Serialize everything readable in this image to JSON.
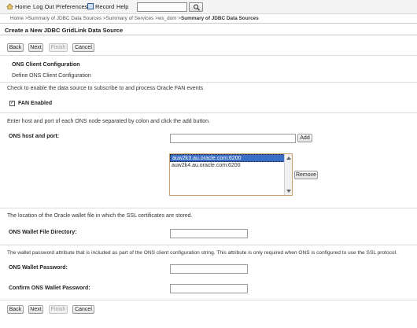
{
  "topnav": {
    "home": "Home",
    "logout": "Log Out",
    "preferences": "Preferences",
    "record": "Record",
    "help": "Help"
  },
  "breadcrumb": {
    "prefix": "Home >Summary of JDBC Data Sources >Summary of Services >ws_dom >",
    "current": "Summary of JDBC Data Sources"
  },
  "page_title": "Create a New JDBC GridLink Data Source",
  "buttons": {
    "back": "Back",
    "next": "Next",
    "finish": "Finish",
    "cancel": "Cancel",
    "add": "Add",
    "remove": "Remove"
  },
  "section": {
    "title": "ONS Client Configuration",
    "subtitle": "Define ONS Client Configuration"
  },
  "fan_text": "Check to enable the data source to subscribe to and process Oracle FAN events",
  "fan_checkbox": {
    "label": "FAN Enabled",
    "checked": true
  },
  "host_text": "Enter host and port of each ONS node separated by colon and click the add button.",
  "host_field": {
    "label": "ONS host and port:",
    "value": ""
  },
  "ons_list": [
    "auw2k3.au.oracle.com:6200",
    "auw2k4.au.oracle.com:6200"
  ],
  "wallet_text": "The location of the Oracle wallet file in which the SSL certificates are stored.",
  "wallet_dir": {
    "label": "ONS Wallet File Directory:",
    "value": ""
  },
  "password_text": "The wallet password attribute that is included as part of the ONS client configuration string. This attribute is only required when ONS is configured to use the SSL protocol.",
  "wallet_pw": {
    "label": "ONS Wallet Password:",
    "value": ""
  },
  "confirm_pw": {
    "label": "Confirm ONS Wallet Password:",
    "value": ""
  }
}
